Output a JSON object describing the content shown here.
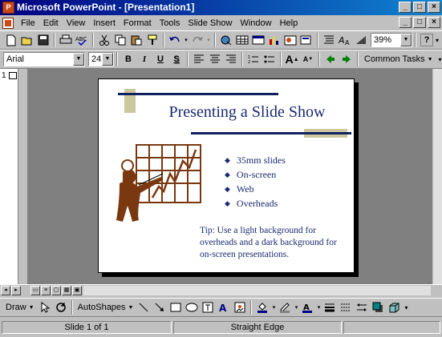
{
  "window": {
    "title": "Microsoft PowerPoint - [Presentation1]",
    "app_icon": "powerpoint-icon",
    "controls": [
      "_",
      "□",
      "×"
    ]
  },
  "menubar": {
    "items": [
      "File",
      "Edit",
      "View",
      "Insert",
      "Format",
      "Tools",
      "Slide Show",
      "Window",
      "Help"
    ],
    "doc_controls": [
      "_",
      "□",
      "×"
    ]
  },
  "standard_toolbar": {
    "zoom": "39%",
    "help": "?"
  },
  "formatting_toolbar": {
    "font": "Arial",
    "size": "24",
    "bold": "B",
    "italic": "I",
    "underline": "U",
    "shadow": "S",
    "common_tasks": "Common Tasks"
  },
  "outline": {
    "slide_number": "1"
  },
  "slide": {
    "title": "Presenting a Slide Show",
    "bullets": [
      "35mm slides",
      "On-screen",
      "Web",
      "Overheads"
    ],
    "tip": "Tip:  Use a light background for overheads and a dark background for on-screen presentations."
  },
  "drawing_toolbar": {
    "draw": "Draw",
    "autoshapes": "AutoShapes"
  },
  "status": {
    "slide": "Slide 1 of 1",
    "design": "Straight Edge"
  },
  "colors": {
    "title_bar": "#000080",
    "slide_text": "#1a2a70",
    "accent_tan": "#cdc7a0",
    "chart_brown": "#7a3810"
  }
}
